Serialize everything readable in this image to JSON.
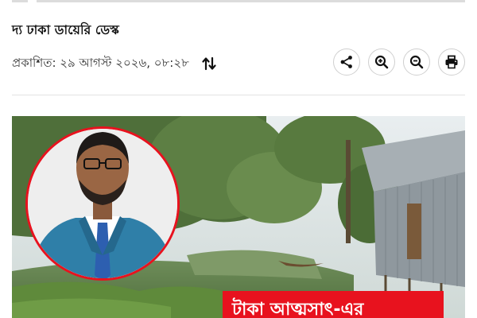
{
  "article": {
    "desk": "দ্য ঢাকা ডায়েরি ডেস্ক",
    "published": "প্রকাশিত: ২৯ আগস্ট ২০২৬, ০৮:২৮"
  },
  "icons": {
    "sort": "sort-arrows-icon",
    "share": "share-icon",
    "zoom_in": "zoom-in-icon",
    "zoom_out": "zoom-out-icon",
    "print": "print-icon"
  },
  "image": {
    "overlay_text": "টাকা আত্মসাৎ-এর"
  },
  "colors": {
    "overlay_bg": "#e8121e",
    "portrait_ring": "#e8121e"
  }
}
